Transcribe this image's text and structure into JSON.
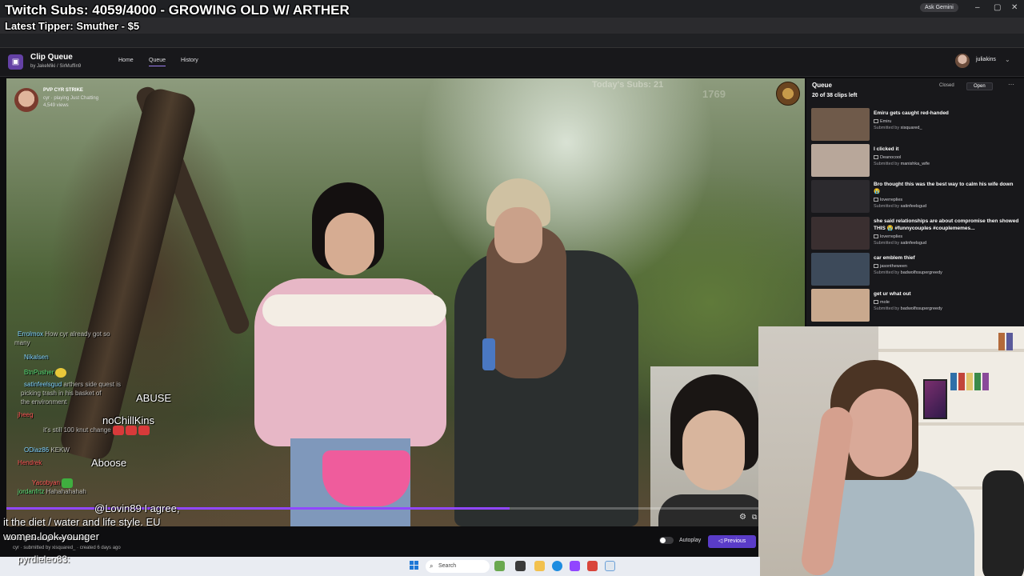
{
  "overlay": {
    "title": "Twitch Subs: 4059/4000 - GROWING OLD W/ ARTHER",
    "latest_tipper": "Latest Tipper: Smuther - $5"
  },
  "browser": {
    "ask_gemini": "Ask Gemini"
  },
  "site": {
    "brand": "Clip Queue",
    "brand_by": "by JakeMiki / SirMuffin9",
    "nav": [
      "Home",
      "Queue",
      "History"
    ],
    "active_nav": "Queue",
    "user": "juliakins"
  },
  "player": {
    "streamer_title": "PVP CYR STRIKE",
    "streamer_sub": "cyr · playing Just Chatting",
    "views": "4,549 views",
    "watermark_subs": "Today's Subs: 21",
    "watermark_num": "1769",
    "progress": 0.63,
    "chat": [
      {
        "name": "Errolmox",
        "text": "How cyr already got so"
      },
      {
        "name": "",
        "text": "many"
      },
      {
        "name": "Nikalsen",
        "text": ""
      },
      {
        "name": "BtnPusher",
        "text": ""
      },
      {
        "name": "satinfeelsgud",
        "text": "arthers side quest is"
      },
      {
        "name": "",
        "text": "picking trash in his basket of"
      },
      {
        "name": "",
        "text": "the environment"
      },
      {
        "name": "jheeg",
        "text": ""
      },
      {
        "name": "",
        "text": "it's still 100 knut change"
      },
      {
        "name": "ODiaz86",
        "text": "KEKW"
      },
      {
        "name": "Hendrek",
        "text": ""
      },
      {
        "name": "Yacobyan",
        "text": ""
      },
      {
        "name": "jordanfrtz",
        "text": "Hahahahahah"
      }
    ],
    "big_chat": [
      {
        "text": "ABUSE"
      },
      {
        "text": "noChillKins"
      },
      {
        "text": "Aboose"
      },
      {
        "text": "@Lovin89 I agree,"
      },
      {
        "text": "it the diet / water and life style. EU"
      },
      {
        "text": "women look younger"
      }
    ],
    "bottom_name": "pyrdieleo83:"
  },
  "clip_meta": {
    "title": "Emiru gets caught red-handed",
    "sub": "cyr · submitted by xisquared_ · created 6 days ago"
  },
  "controls": {
    "autoplay": "Autoplay",
    "previous": "Previous"
  },
  "queue": {
    "title": "Queue",
    "tab_closed": "Closed",
    "tab_open": "Open",
    "count": "20 of 38 clips left",
    "items": [
      {
        "title": "Emiru gets caught red-handed",
        "channel": "Emiru",
        "by_label": "Submitted by",
        "by": "xisquared_",
        "thumb": "#6f5a4a"
      },
      {
        "title": "I clicked it",
        "channel": "Deanocool",
        "by_label": "Submitted by",
        "by": "manishka_wife",
        "thumb": "#b8a79a"
      },
      {
        "title": "Bro thought this was the best way to calm his wife down 😭",
        "channel": "loverreplies",
        "by_label": "Submitted by",
        "by": "satinfeelsgud",
        "thumb": "#2c2a2e"
      },
      {
        "title": "she said relationships are about compromise then showed THIS 😭 #funnycouples #couplememes...",
        "channel": "loverreplies",
        "by_label": "Submitted by",
        "by": "satinfeelsgud",
        "thumb": "#3a2f30"
      },
      {
        "title": "car emblem thief",
        "channel": "jasontheween",
        "by_label": "Submitted by",
        "by": "badwolfxsupergreedy",
        "thumb": "#3d4a5a"
      },
      {
        "title": "get ur what out",
        "channel": "mole",
        "by_label": "Submitted by",
        "by": "badwolfxsupergreedy",
        "thumb": "#c9a98e"
      }
    ]
  },
  "taskbar": {
    "search_placeholder": "Search"
  }
}
